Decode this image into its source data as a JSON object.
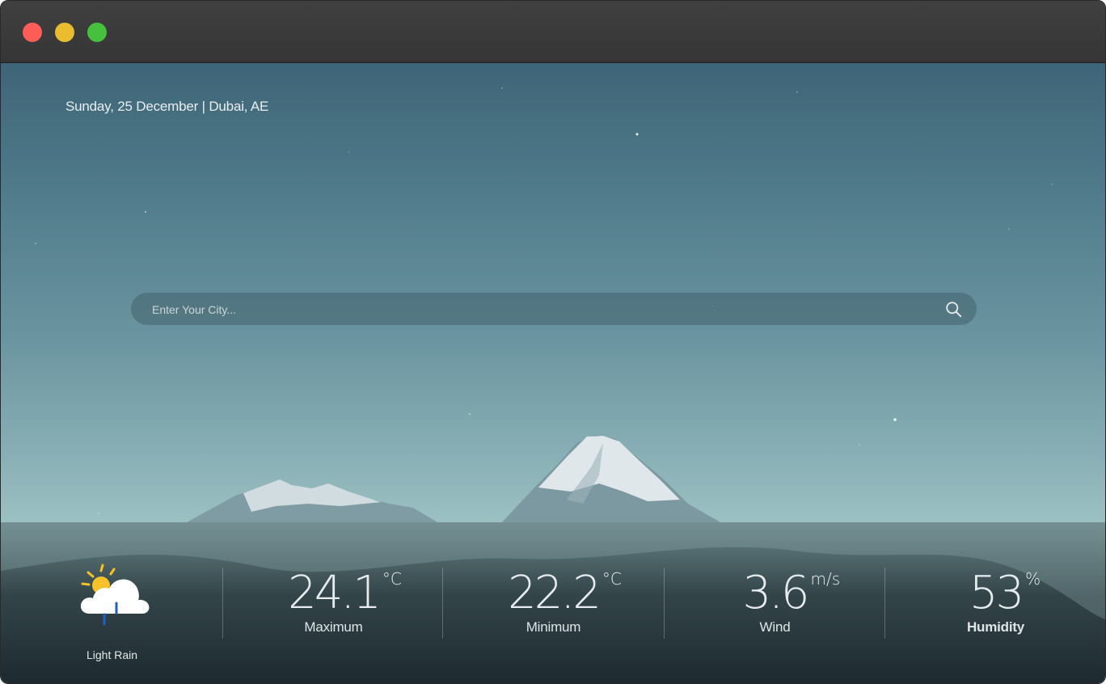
{
  "window": {
    "controls": [
      "close",
      "minimize",
      "maximize"
    ]
  },
  "header": {
    "date_location": "Sunday, 25 December | Dubai, AE"
  },
  "search": {
    "placeholder": "Enter Your City...",
    "value": "",
    "icon": "search-icon"
  },
  "weather": {
    "condition": {
      "icon": "cloud-sun-rain-icon",
      "label": "Light Rain"
    },
    "stats": [
      {
        "value": "24.1",
        "unit": "°C",
        "label": "Maximum"
      },
      {
        "value": "22.2",
        "unit": "°C",
        "label": "Minimum"
      },
      {
        "value": "3.6",
        "unit": "m/s",
        "label": "Wind"
      },
      {
        "value": "53",
        "unit": "%",
        "label": "Humidity"
      }
    ]
  },
  "colors": {
    "close": "#fd5c57",
    "minimize": "#e9bd2d",
    "maximize": "#47c03d",
    "sun": "#f5c22a",
    "rain": "#1f5fc4"
  }
}
